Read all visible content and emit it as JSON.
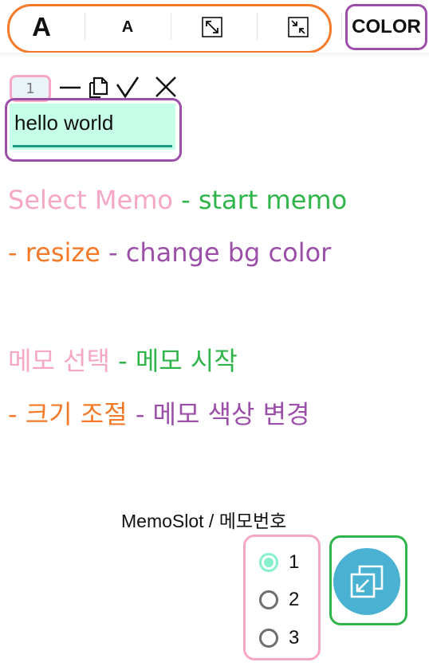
{
  "toolbar": {
    "font_large_label": "A",
    "font_small_label": "A",
    "expand_icon": "expand-arrows-icon",
    "shrink_icon": "shrink-arrows-icon",
    "color_label": "COLOR"
  },
  "memo": {
    "slot_number": "1",
    "controls": [
      "minimize-icon",
      "copy-icon",
      "check-icon",
      "close-icon"
    ],
    "text": "hello world",
    "background": "#c6ffe8"
  },
  "legend_en": {
    "select": "Select Memo",
    "sep1": " - ",
    "start": "start memo",
    "line2_dash": "- ",
    "resize": "resize",
    "sep2": " - ",
    "color": "change bg color"
  },
  "legend_ko": {
    "select": "메모 선택",
    "sep1": " - ",
    "start": "메모 시작",
    "line2_dash": "- ",
    "resize": "크기 조절",
    "sep2": " - ",
    "color": "메모 색상 변경"
  },
  "slot": {
    "title": "MemoSlot / 메모번호",
    "options": [
      "1",
      "2",
      "3"
    ],
    "selected": "1"
  },
  "fab_icon": "open-memo-window-icon",
  "colors": {
    "pink": "#f6a7c5",
    "green": "#2fb54a",
    "orange": "#f47a29",
    "purple": "#9b4fa8",
    "memo_bg": "#c6ffe8",
    "fab": "#49b2d2"
  }
}
